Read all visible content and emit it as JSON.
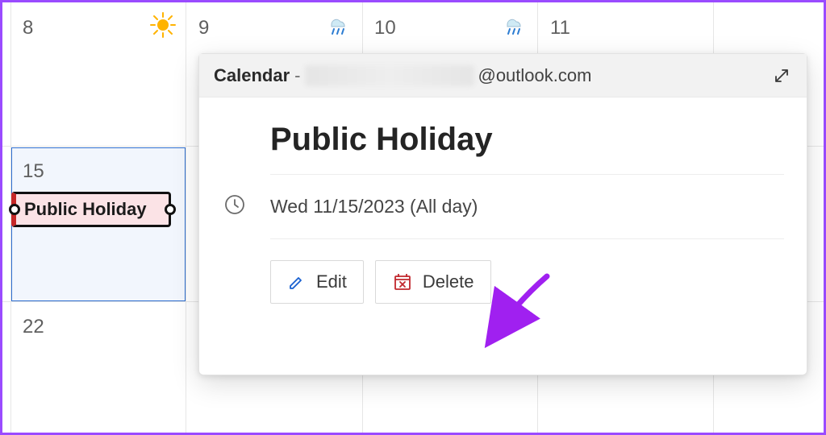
{
  "days": {
    "d8": "8",
    "d9": "9",
    "d10": "10",
    "d11": "11",
    "d15": "15",
    "d22": "22"
  },
  "event_pill": {
    "label": "Public Holiday"
  },
  "popout": {
    "header": {
      "calendar_label": "Calendar",
      "dash": " - ",
      "email_domain": "@outlook.com"
    },
    "event_title": "Public Holiday",
    "time_text": "Wed 11/15/2023 (All day)",
    "buttons": {
      "edit": "Edit",
      "delete": "Delete"
    }
  }
}
